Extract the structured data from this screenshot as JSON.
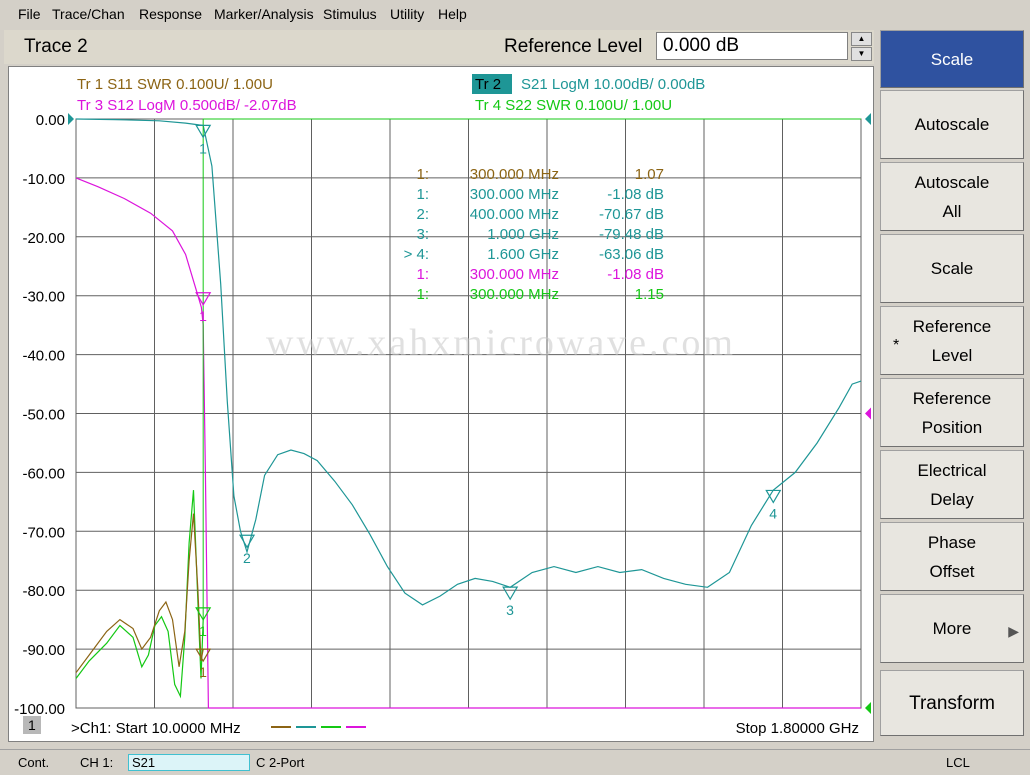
{
  "menu": [
    "File",
    "Trace/Chan",
    "Response",
    "Marker/Analysis",
    "Stimulus",
    "Utility",
    "Help"
  ],
  "title": "Trace 2",
  "reference": {
    "label": "Reference Level",
    "value": "0.000 dB"
  },
  "traces": [
    {
      "label": "Tr  1   S11 SWR 0.100U/  1.00U",
      "color": "#8c6414"
    },
    {
      "label": "Tr  2",
      "sub": "S21 LogM 10.00dB/  0.00dB",
      "color": "#1e9696",
      "active": true
    },
    {
      "label": "Tr  3   S12 LogM 0.500dB/  -2.07dB",
      "color": "#dc14dc"
    },
    {
      "label": "Tr  4   S22 SWR 0.100U/  1.00U",
      "color": "#14c814"
    }
  ],
  "marker_table": [
    {
      "id": "1:",
      "freq": "300.000 MHz",
      "value": "1.07",
      "color": "#8c6414"
    },
    {
      "id": "1:",
      "freq": "300.000 MHz",
      "value": "-1.08 dB",
      "color": "#1e9696"
    },
    {
      "id": "2:",
      "freq": "400.000 MHz",
      "value": "-70.67 dB",
      "color": "#1e9696"
    },
    {
      "id": "3:",
      "freq": "1.000 GHz",
      "value": "-79.48 dB",
      "color": "#1e9696"
    },
    {
      "id": "> 4:",
      "freq": "1.600 GHz",
      "value": "-63.06 dB",
      "color": "#1e9696"
    },
    {
      "id": "1:",
      "freq": "300.000 MHz",
      "value": "-1.08 dB",
      "color": "#dc14dc"
    },
    {
      "id": "1:",
      "freq": "300.000 MHz",
      "value": "1.15",
      "color": "#14c814"
    }
  ],
  "watermark": "www.xahxmicrowave.com",
  "chart_data": {
    "type": "line",
    "x_start_mhz": 10,
    "x_stop_mhz": 1800,
    "ylim": [
      -100,
      0
    ],
    "yticks": [
      "0.00",
      "-10.00",
      "-20.00",
      "-30.00",
      "-40.00",
      "-50.00",
      "-60.00",
      "-70.00",
      "-80.00",
      "-90.00",
      "-100.00"
    ],
    "grid": true,
    "series": [
      {
        "name": "S21",
        "color": "#1e9696",
        "x": [
          10,
          100,
          200,
          260,
          290,
          300,
          320,
          340,
          355,
          370,
          385,
          400,
          420,
          440,
          470,
          500,
          530,
          560,
          600,
          640,
          680,
          720,
          760,
          800,
          840,
          880,
          920,
          960,
          1000,
          1050,
          1100,
          1150,
          1200,
          1250,
          1300,
          1350,
          1400,
          1450,
          1500,
          1550,
          1600,
          1650,
          1700,
          1750,
          1780,
          1800
        ],
        "y": [
          0,
          -0.1,
          -0.3,
          -0.7,
          -1,
          -1.08,
          -8,
          -28,
          -48,
          -64,
          -70,
          -73.5,
          -68,
          -60.5,
          -57,
          -56.2,
          -56.8,
          -58,
          -61.5,
          -65.5,
          -70.5,
          -76,
          -80.5,
          -82.5,
          -81,
          -79,
          -78,
          -78.5,
          -79.5,
          -77,
          -76,
          -77,
          -76,
          -77,
          -76.5,
          -78,
          -79,
          -79.5,
          -77,
          -69,
          -63,
          -60,
          -55,
          -49,
          -45,
          -44.5
        ]
      },
      {
        "name": "S12",
        "color": "#dc14dc",
        "x": [
          10,
          60,
          120,
          180,
          230,
          260,
          280,
          290,
          296,
          300,
          305,
          312,
          330,
          500,
          1000,
          1800
        ],
        "y": [
          -10,
          -11.5,
          -13.5,
          -16,
          -19,
          -23,
          -28,
          -30.5,
          -32,
          -35,
          -60,
          -100,
          -100,
          -100,
          -100,
          -100
        ],
        "note_y_scale": "0.500dB per division, ref -2.07dB"
      },
      {
        "name": "S11",
        "color": "#8c6414",
        "x": [
          10,
          40,
          80,
          110,
          140,
          160,
          180,
          200,
          215,
          230,
          245,
          258,
          268,
          278,
          288,
          295,
          300
        ],
        "y": [
          -94,
          -91,
          -87,
          -85,
          -86.5,
          -90,
          -88,
          -83.5,
          -82,
          -85,
          -93,
          -87,
          -75,
          -67,
          -80,
          -92,
          -90
        ]
      },
      {
        "name": "S22",
        "color": "#14c814",
        "x": [
          10,
          40,
          80,
          110,
          140,
          160,
          175,
          190,
          205,
          220,
          235,
          248,
          258,
          268,
          278,
          288,
          295,
          300
        ],
        "y": [
          -95,
          -92,
          -89,
          -86,
          -88,
          -93,
          -91,
          -86,
          -84.5,
          -87,
          -96,
          -98,
          -88,
          -72,
          -63,
          -82,
          -95,
          -85
        ]
      }
    ],
    "markers": [
      {
        "label": "1",
        "x": 300,
        "y": -1.08,
        "color": "#1e9696"
      },
      {
        "label": "2",
        "x": 400,
        "y": -70.67,
        "color": "#1e9696"
      },
      {
        "label": "3",
        "x": 1000,
        "y": -79.48,
        "color": "#1e9696"
      },
      {
        "label": "4",
        "x": 1600,
        "y": -63.06,
        "color": "#1e9696"
      },
      {
        "label": "1",
        "x": 300,
        "y": -29.5,
        "color": "#dc14dc"
      },
      {
        "label": "1",
        "x": 300,
        "y": -90,
        "color": "#8c6414"
      },
      {
        "label": "1",
        "x": 300,
        "y": -83,
        "color": "#14c814"
      }
    ]
  },
  "footer": {
    "channel_no": "1",
    "start": ">Ch1: Start  10.0000 MHz",
    "stop": "Stop  1.80000 GHz"
  },
  "softkeys": [
    {
      "label": "Scale",
      "active": true
    },
    {
      "label": "Autoscale"
    },
    {
      "label": "Autoscale\nAll"
    },
    {
      "label": "Scale"
    },
    {
      "label": "Reference\nLevel",
      "mark": "*"
    },
    {
      "label": "Reference\nPosition"
    },
    {
      "label": "Electrical\nDelay"
    },
    {
      "label": "Phase\nOffset"
    },
    {
      "label": "More",
      "arrow": "▶"
    },
    {
      "label": "Transform"
    }
  ],
  "status": {
    "mode": "Cont.",
    "channel": "CH 1:",
    "measurement": "S21",
    "cal": "C  2-Port",
    "lcl": "LCL"
  }
}
